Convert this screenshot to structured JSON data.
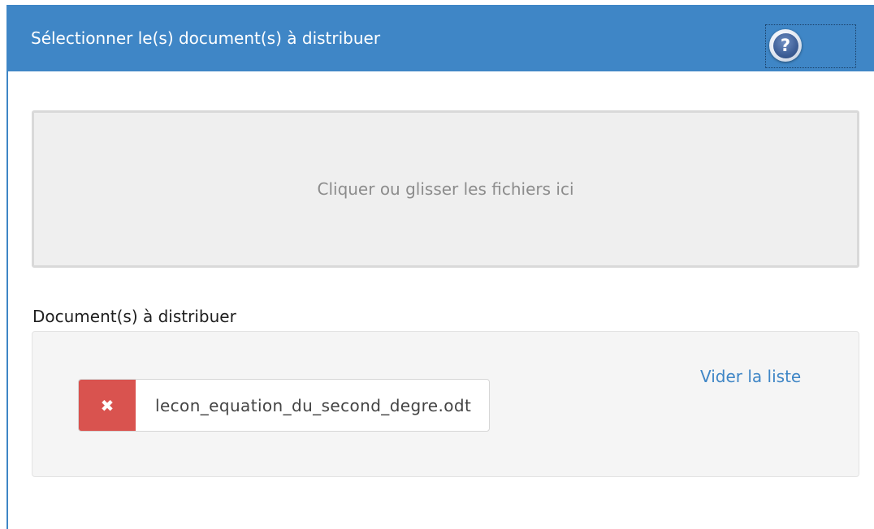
{
  "header": {
    "title": "Sélectionner le(s) document(s) à distribuer",
    "help_glyph": "?",
    "help_icon": "help-icon"
  },
  "dropzone": {
    "label": "Cliquer ou glisser les fichiers ici"
  },
  "files_section": {
    "title": "Document(s) à distribuer",
    "clear_label": "Vider la liste",
    "files": [
      {
        "name": "lecon_equation_du_second_degre.odt",
        "remove_glyph": "✖",
        "remove_icon": "close-icon"
      }
    ]
  },
  "colors": {
    "header_bg": "#3f86c6",
    "remove_bg": "#d9534f",
    "link": "#3f86c6"
  }
}
